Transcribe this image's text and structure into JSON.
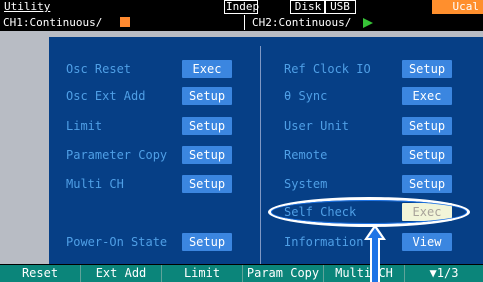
{
  "title": "Utility",
  "header": {
    "mode": "Indep",
    "disk": "Disk",
    "usb": "USB",
    "ucal": "Ucal",
    "accent_color": "#ff8f2d"
  },
  "channels": {
    "ch1": "CH1:Continuous/",
    "ch1_icon": "orange-square-icon",
    "ch2": "CH2:Continuous/",
    "ch2_icon": "green-play-icon"
  },
  "left_items": [
    {
      "label": "Osc Reset",
      "button": "Exec"
    },
    {
      "label": "Osc Ext Add",
      "button": "Setup"
    },
    {
      "label": "Limit",
      "button": "Setup"
    },
    {
      "label": "Parameter Copy",
      "button": "Setup"
    },
    {
      "label": "Multi CH",
      "button": "Setup"
    },
    {
      "label": "Power-On State",
      "button": "Setup"
    }
  ],
  "right_items": [
    {
      "label": "Ref Clock IO",
      "button": "Setup"
    },
    {
      "label": "θ Sync",
      "button": "Exec"
    },
    {
      "label": "User Unit",
      "button": "Setup"
    },
    {
      "label": "Remote",
      "button": "Setup"
    },
    {
      "label": "System",
      "button": "Setup"
    },
    {
      "label": "Self Check",
      "button": "Exec"
    },
    {
      "label": "Information",
      "button": "View"
    }
  ],
  "softkeys": [
    "Reset",
    "Ext Add",
    "Limit",
    "Param Copy",
    "Multi CH",
    "▼1/3"
  ],
  "colors": {
    "panel_bg": "#063f86",
    "label": "#4f9fe6",
    "button": "#3b86e0",
    "button_highlight": "#f2f5d8",
    "softkey_bar": "#0b857a",
    "annotation": "#1e74e6"
  }
}
